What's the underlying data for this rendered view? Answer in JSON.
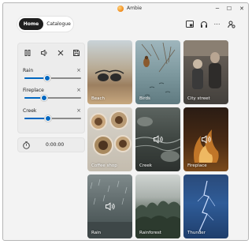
{
  "app": {
    "title": "Ambie"
  },
  "window": {
    "minimize": "─",
    "maximize": "☐",
    "close": "✕"
  },
  "nav": {
    "home": "Home",
    "catalogue": "Catalogue"
  },
  "toolbar": {
    "more": "⋯"
  },
  "mixer": {
    "tracks": [
      {
        "name": "Rain",
        "volume": 0.4,
        "remove": "×"
      },
      {
        "name": "Fireplace",
        "volume": 0.35,
        "remove": "×"
      },
      {
        "name": "Creek",
        "volume": 0.42,
        "remove": "×"
      }
    ]
  },
  "timer": {
    "value": "0:00:00"
  },
  "sounds": [
    {
      "name": "Beach",
      "playing": false
    },
    {
      "name": "Birds",
      "playing": false
    },
    {
      "name": "City street",
      "playing": false
    },
    {
      "name": "Coffee shop",
      "playing": false
    },
    {
      "name": "Creek",
      "playing": true
    },
    {
      "name": "Fireplace",
      "playing": true
    },
    {
      "name": "Rain",
      "playing": true
    },
    {
      "name": "Rainforest",
      "playing": false
    },
    {
      "name": "Thunder",
      "playing": false
    }
  ],
  "colors": {
    "accent": "#0067c0",
    "nav_active": "#1f1f1f",
    "panel": "#ececec"
  }
}
